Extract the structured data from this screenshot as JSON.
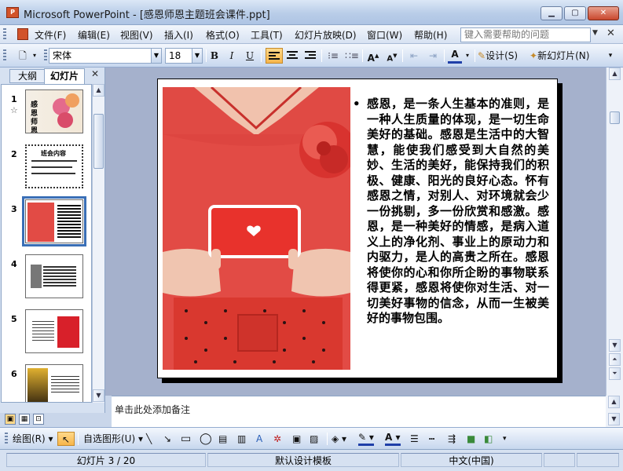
{
  "window": {
    "title": "Microsoft PowerPoint - [感恩师恩主题班会课件.ppt]"
  },
  "menu": {
    "items": [
      "文件(F)",
      "编辑(E)",
      "视图(V)",
      "插入(I)",
      "格式(O)",
      "工具(T)",
      "幻灯片放映(D)",
      "窗口(W)",
      "帮助(H)"
    ],
    "help_placeholder": "键入需要帮助的问题"
  },
  "format_toolbar": {
    "font_name": "宋体",
    "font_size": "18",
    "bold": "B",
    "italic": "I",
    "underline": "U",
    "design_label": "设计(S)",
    "new_slide_label": "新幻灯片(N)"
  },
  "left_pane": {
    "tab_outline": "大纲",
    "tab_slides": "幻灯片",
    "selected_index": 3,
    "slides": [
      {
        "num": "1",
        "text": "感恩 师恩"
      },
      {
        "num": "2",
        "text": "班会内容"
      },
      {
        "num": "3",
        "text": ""
      },
      {
        "num": "4",
        "text": ""
      },
      {
        "num": "5",
        "text": ""
      },
      {
        "num": "6",
        "text": ""
      }
    ]
  },
  "slide": {
    "body_text": "感恩，是一条人生基本的准则，是一种人生质量的体现，是一切生命美好的基础。感恩是生活中的大智慧，能使我们感受到大自然的美妙、生活的美好，能保持我们的积极、健康、阳光的良好心态。怀有感恩之情，对别人、对环境就会少一份挑剔，多一份欣赏和感激。感恩，是一种美好的情感，是病入道义上的净化剂、事业上的原动力和内驱力，是人的高贵之所在。感恩将使你的心和你所企盼的事物联系得更紧，感恩将使你对生活、对一切美好事物的信念，从而一生被美好的事物包围。"
  },
  "notes": {
    "placeholder": "单击此处添加备注"
  },
  "draw_toolbar": {
    "draw_label": "绘图(R)",
    "autoshape_label": "自选图形(U)"
  },
  "status": {
    "slide_position": "幻灯片 3 / 20",
    "template": "默认设计模板",
    "language": "中文(中国)"
  },
  "colors": {
    "selection": "#3a6fb6",
    "photo_red": "#e24b45",
    "accent_orange": "#d2532a"
  }
}
